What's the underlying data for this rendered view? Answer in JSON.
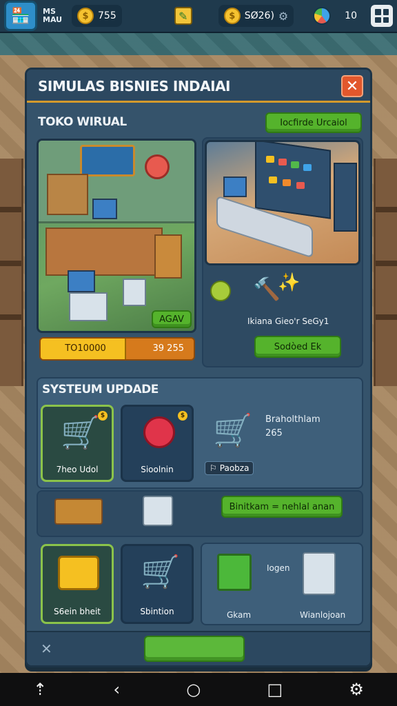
{
  "hud": {
    "brand_label": "MS\nMAU",
    "coins": "755",
    "gems": "SØ26)",
    "level": "10"
  },
  "panel": {
    "title": "SIMULAS BISNIES INDAIAI",
    "close_label": "✕"
  },
  "store_section": {
    "title": "TOKO WIRUAL",
    "header_button": "Iocfirde Urcaiol",
    "left_scene_button": "AGAV",
    "progress_label": "TO10000",
    "progress_value": "39 255",
    "progress_fraction": 0.56,
    "right_caption": "Ikiana Gieo'r SeGy1",
    "right_button": "Sodòed Ek"
  },
  "upgrade_section": {
    "title": "SYSTEUM UPDADE",
    "tiles": [
      {
        "label": "7heo Udol",
        "badge": "$"
      },
      {
        "label": "Sioolnin",
        "badge": "$"
      }
    ],
    "side_label": "Braholthlam",
    "side_value": "265",
    "side_pill": "Paobza"
  },
  "action_row": {
    "button": "Binitkam = nehlal anan"
  },
  "bottom_tiles": [
    {
      "label": "S6ein bheit"
    },
    {
      "label": "Sbintion"
    }
  ],
  "bottom_panel": {
    "top_label": "Iogen",
    "left_label": "Gkam",
    "right_label": "Wianlojoan"
  },
  "footer": {
    "close_label": "✕"
  },
  "colors": {
    "accent_green": "#55b32c",
    "panel_blue": "#35536b",
    "close_red": "#e2572c",
    "progress_yellow": "#f5c021",
    "progress_orange": "#d67a1c"
  },
  "icons": [
    "logo-icon",
    "coin-icon",
    "pencil-icon",
    "settings-icon",
    "globe-icon",
    "grid-icon",
    "cart-icon",
    "lock-icon",
    "gold-coins-icon",
    "box-icon",
    "cash-register-icon",
    "shelf-icon",
    "back-icon",
    "home-icon",
    "recent-icon",
    "gear-icon"
  ]
}
